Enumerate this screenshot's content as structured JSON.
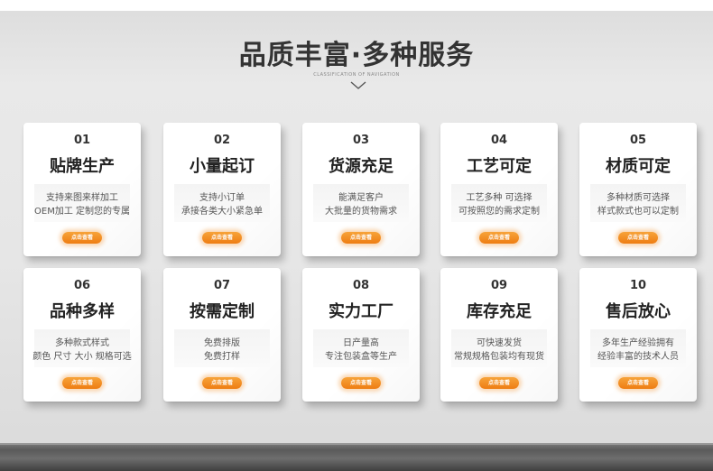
{
  "header": {
    "title": "品质丰富·多种服务",
    "subtitle": "CLASSIFICATION OF NAVIGATION",
    "chevron_icon": "chevron-down-icon"
  },
  "colors": {
    "button_orange": "#ee7d12",
    "card_bg": "#ffffff",
    "page_bg": "#e6e6e6"
  },
  "cards": [
    {
      "num": "01",
      "title": "贴牌生产",
      "line1": "支持来图来样加工",
      "line2": "OEM加工 定制您的专属",
      "button": "点击查看"
    },
    {
      "num": "02",
      "title": "小量起订",
      "line1": "支持小订单",
      "line2": "承接各类大小紧急单",
      "button": "点击查看"
    },
    {
      "num": "03",
      "title": "货源充足",
      "line1": "能满足客户",
      "line2": "大批量的货物需求",
      "button": "点击查看"
    },
    {
      "num": "04",
      "title": "工艺可定",
      "line1": "工艺多种 可选择",
      "line2": "可按照您的需求定制",
      "button": "点击查看"
    },
    {
      "num": "05",
      "title": "材质可定",
      "line1": "多种材质可选择",
      "line2": "样式款式也可以定制",
      "button": "点击查看"
    },
    {
      "num": "06",
      "title": "品种多样",
      "line1": "多种款式样式",
      "line2": "颜色 尺寸 大小 规格可选",
      "button": "点击查看"
    },
    {
      "num": "07",
      "title": "按需定制",
      "line1": "免费排版",
      "line2": "免费打样",
      "button": "点击查看"
    },
    {
      "num": "08",
      "title": "实力工厂",
      "line1": "日产量高",
      "line2": "专注包装盒等生产",
      "button": "点击查看"
    },
    {
      "num": "09",
      "title": "库存充足",
      "line1": "可快速发货",
      "line2": "常规规格包装均有现货",
      "button": "点击查看"
    },
    {
      "num": "10",
      "title": "售后放心",
      "line1": "多年生产经验拥有",
      "line2": "经验丰富的技术人员",
      "button": "点击查看"
    }
  ]
}
